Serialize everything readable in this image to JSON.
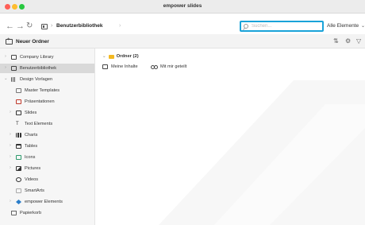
{
  "window": {
    "title": "empower slides"
  },
  "toolbar": {
    "breadcrumb": "Benutzerbibliothek",
    "search": {
      "value": "",
      "placeholder": "Suchen..."
    },
    "filter_label": "Alle Elemente"
  },
  "actionbar": {
    "new_folder_label": "Neuer Ordner"
  },
  "sidebar": {
    "items": [
      {
        "label": "Company Library"
      },
      {
        "label": "Benutzerbibliothek",
        "selected": true
      },
      {
        "label": "Design Vorlagen"
      },
      {
        "label": "Master Templates"
      },
      {
        "label": "Präsentationen"
      },
      {
        "label": "Slides"
      },
      {
        "label": "Text Elements"
      },
      {
        "label": "Charts"
      },
      {
        "label": "Tables"
      },
      {
        "label": "Icons"
      },
      {
        "label": "Pictures"
      },
      {
        "label": "Videos"
      },
      {
        "label": "SmartArts"
      },
      {
        "label": "empower Elements"
      },
      {
        "label": "Papierkorb"
      }
    ]
  },
  "main": {
    "group_title": "Ordner (2)",
    "folders": [
      {
        "label": "Meine Inhalte"
      },
      {
        "label": "Mit mir geteilt"
      }
    ]
  },
  "icons": {
    "back": "arrow-left-icon",
    "forward": "arrow-right-icon",
    "refresh": "refresh-icon",
    "search": "search-icon",
    "sort": "sort-icon",
    "view": "view-options-icon",
    "filter": "filter-icon"
  },
  "colors": {
    "search_border": "#1aa3d9",
    "folder": "#f3b922",
    "selected_row": "#d9d9d9"
  }
}
